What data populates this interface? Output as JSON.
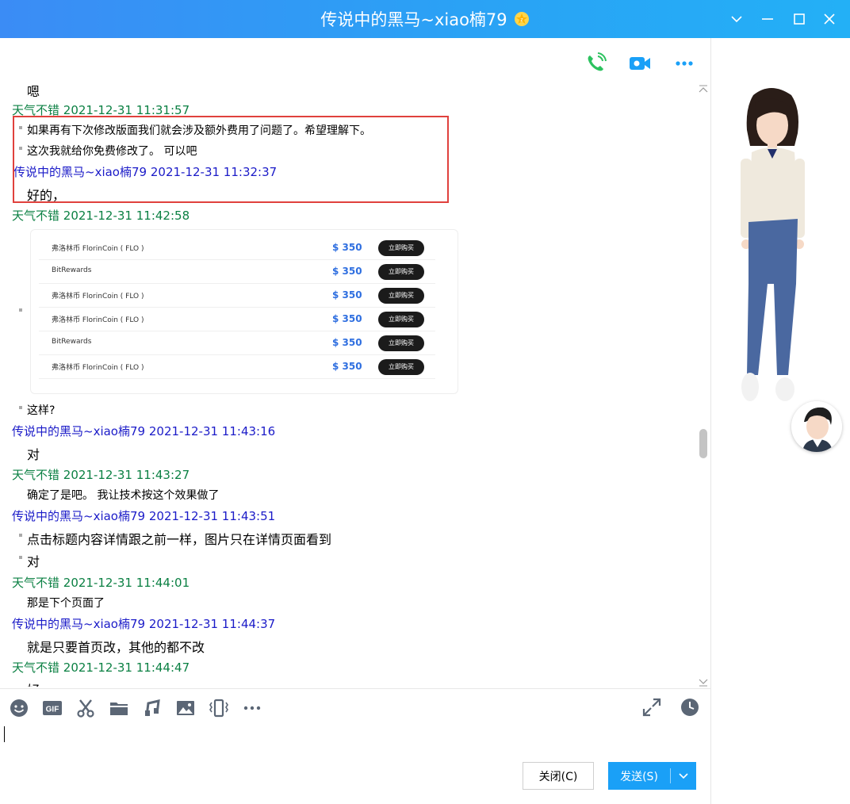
{
  "window": {
    "title": "传说中的黑马~xiao楠79",
    "vip_badge_icon": "vip-star-icon",
    "controls": [
      "chevron-down-icon",
      "minimize-icon",
      "maximize-icon",
      "close-icon"
    ]
  },
  "header_actions": [
    "phone-call-icon",
    "video-call-icon",
    "more-icon"
  ],
  "colors": {
    "title_bar": "#2aa2f5",
    "sender_me": "#0b8043",
    "sender_other": "#1b1bc8",
    "highlight_border": "#e0413d",
    "send_button": "#1aa0f7"
  },
  "messages": [
    {
      "id": "m0",
      "body": "嗯"
    },
    {
      "id": "h1",
      "sender": "天气不错",
      "time": "2021-12-31 11:31:57"
    },
    {
      "id": "m1",
      "body": "如果再有下次修改版面我们就会涉及额外费用了问题了。希望理解下。"
    },
    {
      "id": "m2",
      "body": "这次我就给你免费修改了。 可以吧"
    },
    {
      "id": "h2",
      "sender": "传说中的黑马~xiao楠79",
      "time": "2021-12-31 11:32:37"
    },
    {
      "id": "m3",
      "body": "好的，"
    },
    {
      "id": "h3",
      "sender": "天气不错",
      "time": "2021-12-31 11:42:58"
    },
    {
      "id": "m4",
      "body": "这样?"
    },
    {
      "id": "h4",
      "sender": "传说中的黑马~xiao楠79",
      "time": "2021-12-31 11:43:16"
    },
    {
      "id": "m5",
      "body": "对"
    },
    {
      "id": "h5",
      "sender": "天气不错",
      "time": "2021-12-31 11:43:27"
    },
    {
      "id": "m6",
      "body": "确定了是吧。 我让技术按这个效果做了"
    },
    {
      "id": "h6",
      "sender": "传说中的黑马~xiao楠79",
      "time": "2021-12-31 11:43:51"
    },
    {
      "id": "m7",
      "body": "点击标题内容详情跟之前一样，图片只在详情页面看到"
    },
    {
      "id": "m8",
      "body": "对"
    },
    {
      "id": "h7",
      "sender": "天气不错",
      "time": "2021-12-31 11:44:01"
    },
    {
      "id": "m9",
      "body": "那是下个页面了"
    },
    {
      "id": "h8",
      "sender": "传说中的黑马~xiao楠79",
      "time": "2021-12-31 11:44:37"
    },
    {
      "id": "m10",
      "body": "就是只要首页改，其他的都不改"
    },
    {
      "id": "h9",
      "sender": "天气不错",
      "time": "2021-12-31 11:44:47"
    },
    {
      "id": "m11",
      "body": "好"
    }
  ],
  "shared_image": {
    "rows": [
      {
        "name": "弗洛林币 FlorinCoin ( FLO )",
        "price": "$ 350",
        "button": "立即购买"
      },
      {
        "name": "BitRewards",
        "price": "$ 350",
        "button": "立即购买"
      },
      {
        "name": "弗洛林币 FlorinCoin ( FLO )",
        "price": "$ 350",
        "button": "立即购买"
      },
      {
        "name": "弗洛林币 FlorinCoin ( FLO )",
        "price": "$ 350",
        "button": "立即购买"
      },
      {
        "name": "BitRewards",
        "price": "$ 350",
        "button": "立即购买"
      },
      {
        "name": "弗洛林币 FlorinCoin ( FLO )",
        "price": "$ 350",
        "button": "立即购买"
      }
    ]
  },
  "toolbar": {
    "icons": [
      "emoji-icon",
      "gif-icon",
      "screenshot-scissors-icon",
      "folder-icon",
      "music-icon",
      "image-icon",
      "shake-icon",
      "more-icon"
    ],
    "right_icons": [
      "expand-icon",
      "history-clock-icon"
    ]
  },
  "buttons": {
    "close_label": "关闭(C)",
    "send_label": "发送(S)"
  }
}
